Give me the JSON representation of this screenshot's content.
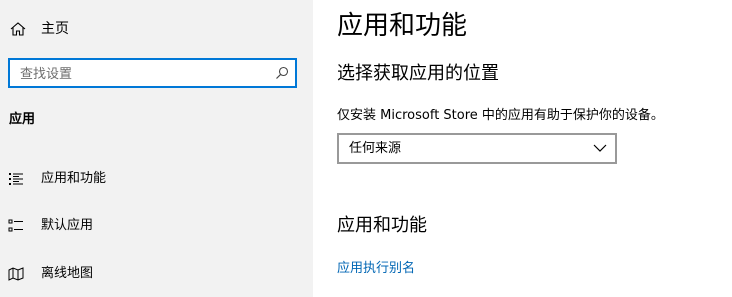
{
  "sidebar": {
    "home_label": "主页",
    "search": {
      "placeholder": "查找设置",
      "value": ""
    },
    "section_label": "应用",
    "items": [
      {
        "label": "应用和功能",
        "icon": "list-icon"
      },
      {
        "label": "默认应用",
        "icon": "default-apps-icon"
      },
      {
        "label": "离线地图",
        "icon": "map-icon"
      }
    ]
  },
  "main": {
    "title": "应用和功能",
    "choose_location_heading": "选择获取应用的位置",
    "description": "仅安装 Microsoft Store 中的应用有助于保护你的设备。",
    "source_dropdown": {
      "selected": "任何来源"
    },
    "apps_features_heading": "应用和功能",
    "alias_link": "应用执行别名"
  },
  "colors": {
    "sidebar_bg": "#f2f2f2",
    "accent": "#0078d7",
    "link": "#0066b4"
  }
}
